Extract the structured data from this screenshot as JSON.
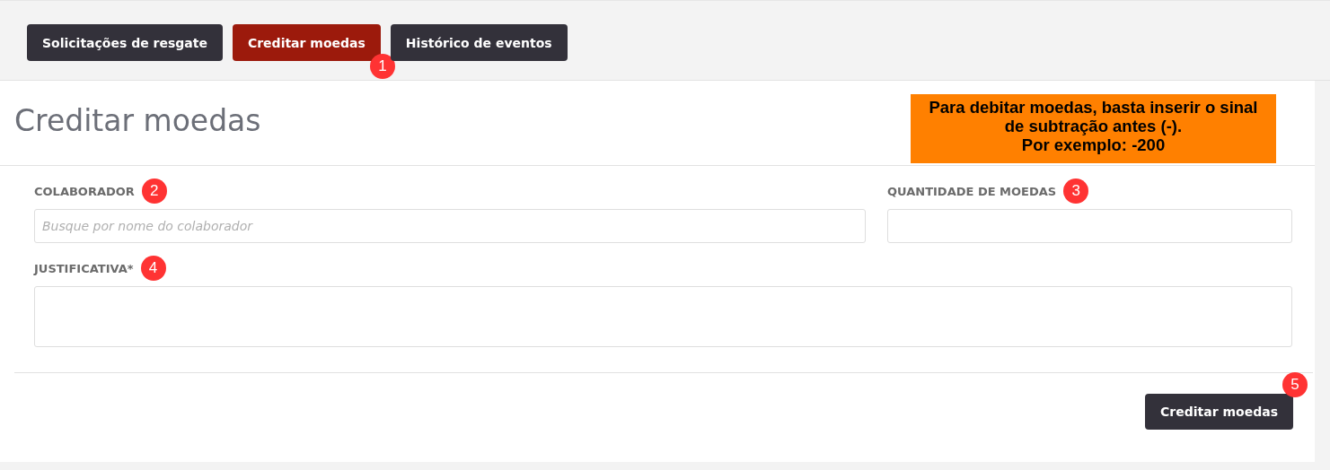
{
  "tabs": [
    {
      "label": "Solicitações de resgate",
      "selected": false
    },
    {
      "label": "Creditar moedas",
      "selected": true,
      "marker": "1"
    },
    {
      "label": "Histórico de eventos",
      "selected": false
    }
  ],
  "page_title": "Creditar moedas",
  "note": {
    "lines": [
      "Para debitar moedas, basta inserir o sinal",
      "de subtração antes (-).",
      "Por exemplo: -200"
    ]
  },
  "fields": [
    {
      "kind": "input",
      "label": "COLABORADOR",
      "marker": "2",
      "placeholder": "Busque por nome do colaborador"
    },
    {
      "kind": "input",
      "label": "QUANTIDADE DE MOEDAS",
      "marker": "3"
    },
    {
      "kind": "textarea",
      "label": "JUSTIFICATIVA*",
      "marker": "4"
    }
  ],
  "submit_button": {
    "label": "Creditar moedas",
    "marker": "5"
  }
}
